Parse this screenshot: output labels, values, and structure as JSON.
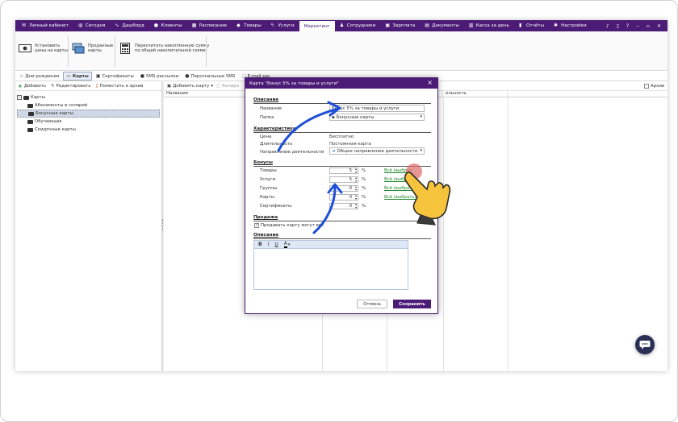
{
  "topnav": {
    "items": [
      {
        "label": "Личный кабинет",
        "icon": "envelope-icon"
      },
      {
        "label": "Сегодня",
        "icon": "globe-icon"
      },
      {
        "label": "Дашборд",
        "icon": "pulse-icon"
      },
      {
        "label": "Клиенты",
        "icon": "user-circle-icon"
      },
      {
        "label": "Расписание",
        "icon": "calendar-icon"
      },
      {
        "label": "Товары",
        "icon": "box-icon"
      },
      {
        "label": "Услуги",
        "icon": "bolt-icon"
      },
      {
        "label": "Маркетинг",
        "icon": "",
        "active": true
      },
      {
        "label": "Сотрудники",
        "icon": "user-icon"
      },
      {
        "label": "Зарплата",
        "icon": "money-icon"
      },
      {
        "label": "Документы",
        "icon": "document-icon"
      },
      {
        "label": "Касса за день",
        "icon": "register-icon"
      },
      {
        "label": "Отчёты",
        "icon": "bars-icon"
      },
      {
        "label": "Настройки",
        "icon": "gear-icon"
      }
    ]
  },
  "ribbon": {
    "btn1": {
      "line1": "Установить",
      "line2": "цены на карты"
    },
    "btn2": {
      "line1": "Проданные",
      "line2": "карты"
    },
    "btn3": {
      "line1": "Пересчитать накопленную сумму",
      "line2": "по общей накопительной схеме"
    }
  },
  "tabs": [
    {
      "label": "Дни рождения"
    },
    {
      "label": "Карты",
      "active": true
    },
    {
      "label": "Сертификаты"
    },
    {
      "label": "SMS рассылки"
    },
    {
      "label": "Персональные SMS"
    },
    {
      "label": "E-mail рас"
    }
  ],
  "left": {
    "add": "Добавить",
    "edit": "Редактировать",
    "archive": "Поместить в архив",
    "root": "Карты",
    "children": [
      "Абонементы в солярий",
      "Бонусные карты",
      "Обучающая",
      "Скидочные карты"
    ]
  },
  "right": {
    "add_card": "Добавить карту",
    "copy": "Копиро",
    "archive_label": "Архив",
    "col_name": "Название",
    "col_other": "ельность"
  },
  "modal": {
    "title": "Карта \"Бонус 5% за товары и услуги\"",
    "sec_description": "Описание",
    "name_label": "Название",
    "name_value": "Бонус 5% за товары и услуги",
    "folder_label": "Папка",
    "folder_value": "Бонусные карты",
    "sec_character": "Характеристика",
    "price_label": "Цена",
    "price_value": "Бесплатно",
    "duration_label": "Длительность",
    "duration_value": "Постоянная карта",
    "direction_label": "Направление деятельности",
    "direction_value": "Общее направление деятельности",
    "sec_bonus": "Бонусы",
    "bonus_rows": [
      {
        "label": "Товары",
        "value": "5",
        "link": "Всё (выбрат"
      },
      {
        "label": "Услуги",
        "value": "5",
        "link": "Всё (выбрать)"
      },
      {
        "label": "Группы",
        "value": "0",
        "link": "Всё (выбрать)"
      },
      {
        "label": "Карты",
        "value": "0",
        "link": "Всё (выбрать)"
      },
      {
        "label": "Сертификаты",
        "value": "0",
        "link": ""
      }
    ],
    "pct": "%",
    "sec_sale": "Продажа",
    "sell_all": "Продавать карту могут все",
    "sec_desc2": "Описание",
    "editor_bold": "B",
    "editor_italic": "I",
    "editor_underline": "U",
    "editor_color": "A",
    "cancel": "Отмена",
    "save": "Сохранить"
  },
  "colors": {
    "accent": "#4b1b76",
    "link_green": "#1c8a2a",
    "annotation_blue": "#1e4fd8"
  }
}
